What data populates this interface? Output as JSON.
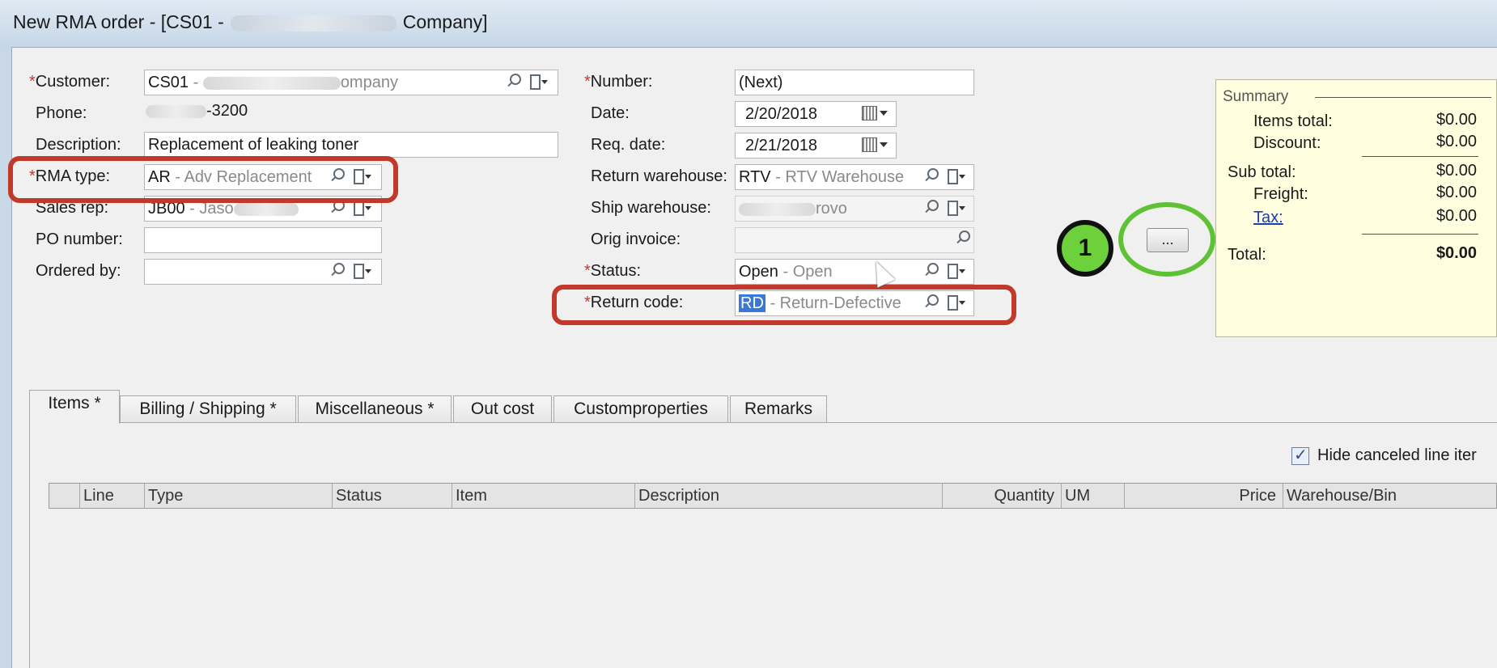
{
  "window": {
    "title_prefix": "New RMA order - [CS01 -",
    "title_suffix": "Company]"
  },
  "left_form": {
    "customer_label": "Customer:",
    "customer_code": "CS01",
    "customer_desc": "ompany",
    "phone_label": "Phone:",
    "phone_value": "-3200",
    "description_label": "Description:",
    "description_value": "Replacement of leaking toner",
    "rma_type_label": "RMA type:",
    "rma_type_code": "AR",
    "rma_type_desc": "- Adv Replacement",
    "sales_rep_label": "Sales rep:",
    "sales_rep_code": "JB00",
    "sales_rep_desc": "- Jaso",
    "po_number_label": "PO number:",
    "po_number_value": "",
    "ordered_by_label": "Ordered by:",
    "ordered_by_value": ""
  },
  "mid_form": {
    "number_label": "Number:",
    "number_value": "(Next)",
    "date_label": "Date:",
    "date_value": "2/20/2018",
    "req_date_label": "Req. date:",
    "req_date_value": "2/21/2018",
    "return_wh_label": "Return warehouse:",
    "return_wh_code": "RTV",
    "return_wh_desc": "- RTV Warehouse",
    "ship_wh_label": "Ship warehouse:",
    "ship_wh_desc": "rovo",
    "orig_invoice_label": "Orig invoice:",
    "orig_invoice_value": "",
    "ellipsis_label": "...",
    "status_label": "Status:",
    "status_code": "Open",
    "status_desc": "- Open",
    "return_code_label": "Return code:",
    "return_code_code": "RD",
    "return_code_desc": "- Return-Defective"
  },
  "annotation": {
    "badge": "1"
  },
  "summary": {
    "title": "Summary",
    "items_total_label": "Items total:",
    "items_total": "$0.00",
    "discount_label": "Discount:",
    "discount": "$0.00",
    "sub_total_label": "Sub total:",
    "sub_total": "$0.00",
    "freight_label": "Freight:",
    "freight": "$0.00",
    "tax_label": "Tax:",
    "tax": "$0.00",
    "total_label": "Total:",
    "total": "$0.00"
  },
  "tabs": [
    "Items *",
    "Billing / Shipping  *",
    "Miscellaneous *",
    "Out cost",
    "Customproperties",
    "Remarks"
  ],
  "items_panel": {
    "hide_canceled_label": "Hide canceled line iter",
    "hide_canceled_checked": true,
    "columns": [
      "Line",
      "Type",
      "Status",
      "Item",
      "Description",
      "Quantity",
      "UM",
      "Price",
      "Warehouse/Bin"
    ]
  },
  "colors": {
    "annotation_red": "#c0392b",
    "annotation_green": "#5ec234",
    "summary_bg": "#ffffe0",
    "selection": "#3a78d6"
  }
}
